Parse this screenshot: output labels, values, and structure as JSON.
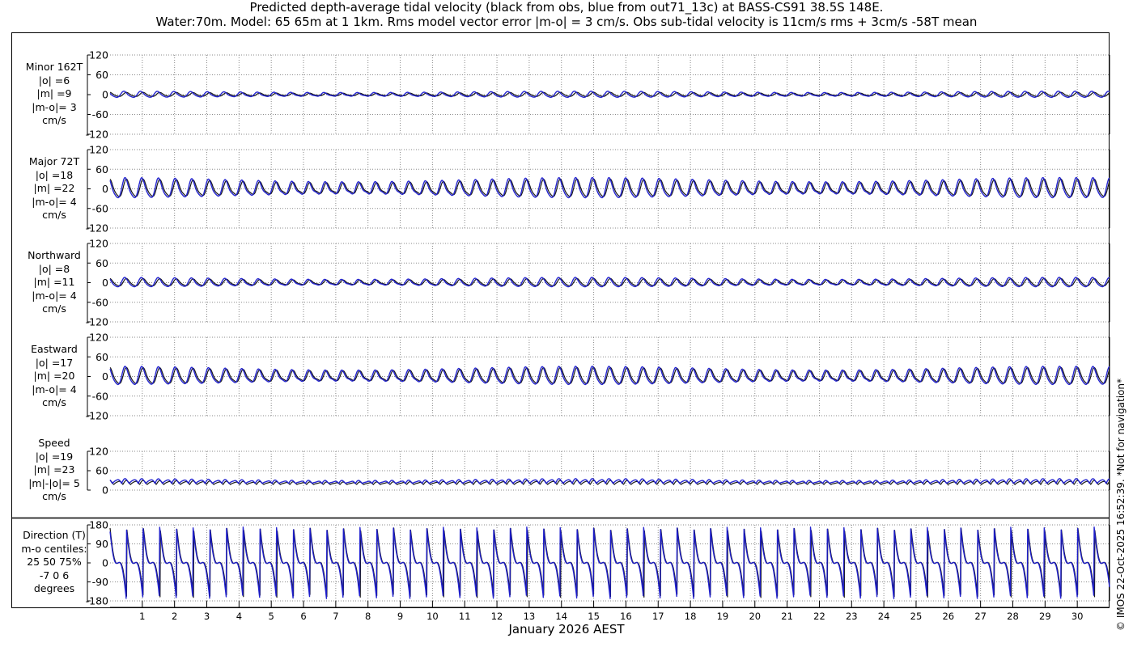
{
  "title_line1": "Predicted depth-average tidal velocity (black from obs, blue from out71_13c) at BASS-CS91 38.5S 148E.",
  "title_line2": "Water:70m. Model: 65 65m at 1 1km. Rms model vector error |m-o| = 3 cm/s. Obs sub-tidal velocity is 11cm/s rms + 3cm/s -58T mean",
  "xlabel": "January 2026 AEST",
  "credit": "© IMOS 22-Oct-2025 16:52:39. *Not for navigation*",
  "colors": {
    "obs": "#000000",
    "model": "#1a1acd",
    "grid": "#8a8a8a"
  },
  "panels": [
    {
      "id": "minor",
      "label_lines": [
        "Minor 162T",
        "|o| =6",
        "|m| =9",
        "|m-o|= 3",
        "cm/s"
      ]
    },
    {
      "id": "major",
      "label_lines": [
        "Major 72T",
        "|o| =18",
        "|m| =22",
        "|m-o|= 4",
        "cm/s"
      ]
    },
    {
      "id": "north",
      "label_lines": [
        "Northward",
        "|o| =8",
        "|m| =11",
        "|m-o|= 4",
        "cm/s"
      ]
    },
    {
      "id": "east",
      "label_lines": [
        "Eastward",
        "|o| =17",
        "|m| =20",
        "|m-o|= 4",
        "cm/s"
      ]
    },
    {
      "id": "speed",
      "label_lines": [
        "Speed",
        "|o| =19",
        "|m| =23",
        "|m|-|o|= 5",
        "cm/s"
      ]
    },
    {
      "id": "dir",
      "label_lines": [
        "Direction (T)",
        "m-o centiles:",
        "25  50  75%",
        "-7  0  6",
        "degrees"
      ]
    }
  ],
  "chart_data": [
    {
      "type": "line",
      "title": "Minor 162T",
      "ylabel": "cm/s",
      "ylim": [
        -120,
        120
      ],
      "yticks": [
        -120,
        -60,
        0,
        60,
        120
      ],
      "xlim": [
        0,
        31
      ],
      "grid": true,
      "xticks": [
        1,
        2,
        3,
        4,
        5,
        6,
        7,
        8,
        9,
        10,
        11,
        12,
        13,
        14,
        15,
        16,
        17,
        18,
        19,
        20,
        21,
        22,
        23,
        24,
        25,
        26,
        27,
        28,
        29,
        30
      ],
      "stats": {
        "obs_rms": 6,
        "model_rms": 9,
        "rms_error": 3
      },
      "series": [
        {
          "name": "obs",
          "amp": 6,
          "phase": 0.0,
          "mean": 0,
          "nonneg": false
        },
        {
          "name": "model",
          "amp": 9,
          "phase": 0.15,
          "mean": 0,
          "nonneg": false
        }
      ]
    },
    {
      "type": "line",
      "title": "Major 72T",
      "ylabel": "cm/s",
      "ylim": [
        -120,
        120
      ],
      "yticks": [
        -120,
        -60,
        0,
        60,
        120
      ],
      "xlim": [
        0,
        31
      ],
      "grid": true,
      "xticks": [
        1,
        2,
        3,
        4,
        5,
        6,
        7,
        8,
        9,
        10,
        11,
        12,
        13,
        14,
        15,
        16,
        17,
        18,
        19,
        20,
        21,
        22,
        23,
        24,
        25,
        26,
        27,
        28,
        29,
        30
      ],
      "stats": {
        "obs_rms": 18,
        "model_rms": 22,
        "rms_error": 4
      },
      "series": [
        {
          "name": "obs",
          "amp": 26,
          "phase": 0.0,
          "mean": 0,
          "nonneg": false
        },
        {
          "name": "model",
          "amp": 30,
          "phase": 0.08,
          "mean": 0,
          "nonneg": false
        }
      ]
    },
    {
      "type": "line",
      "title": "Northward",
      "ylabel": "cm/s",
      "ylim": [
        -120,
        120
      ],
      "yticks": [
        -120,
        -60,
        0,
        60,
        120
      ],
      "xlim": [
        0,
        31
      ],
      "grid": true,
      "xticks": [
        1,
        2,
        3,
        4,
        5,
        6,
        7,
        8,
        9,
        10,
        11,
        12,
        13,
        14,
        15,
        16,
        17,
        18,
        19,
        20,
        21,
        22,
        23,
        24,
        25,
        26,
        27,
        28,
        29,
        30
      ],
      "stats": {
        "obs_rms": 8,
        "model_rms": 11,
        "rms_error": 4
      },
      "series": [
        {
          "name": "obs",
          "amp": 11,
          "phase": 0.0,
          "mean": 0,
          "nonneg": false
        },
        {
          "name": "model",
          "amp": 14,
          "phase": 0.1,
          "mean": 0,
          "nonneg": false
        }
      ]
    },
    {
      "type": "line",
      "title": "Eastward",
      "ylabel": "cm/s",
      "ylim": [
        -120,
        120
      ],
      "yticks": [
        -120,
        -60,
        0,
        60,
        120
      ],
      "xlim": [
        0,
        31
      ],
      "grid": true,
      "xticks": [
        1,
        2,
        3,
        4,
        5,
        6,
        7,
        8,
        9,
        10,
        11,
        12,
        13,
        14,
        15,
        16,
        17,
        18,
        19,
        20,
        21,
        22,
        23,
        24,
        25,
        26,
        27,
        28,
        29,
        30
      ],
      "stats": {
        "obs_rms": 17,
        "model_rms": 20,
        "rms_error": 4
      },
      "series": [
        {
          "name": "obs",
          "amp": 24,
          "phase": 0.0,
          "mean": 0,
          "nonneg": false
        },
        {
          "name": "model",
          "amp": 27,
          "phase": 0.08,
          "mean": 0,
          "nonneg": false
        }
      ]
    },
    {
      "type": "line",
      "title": "Speed",
      "ylabel": "cm/s",
      "ylim": [
        0,
        120
      ],
      "yticks": [
        0,
        60,
        120
      ],
      "xlim": [
        0,
        31
      ],
      "grid": true,
      "xticks": [
        1,
        2,
        3,
        4,
        5,
        6,
        7,
        8,
        9,
        10,
        11,
        12,
        13,
        14,
        15,
        16,
        17,
        18,
        19,
        20,
        21,
        22,
        23,
        24,
        25,
        26,
        27,
        28,
        29,
        30
      ],
      "stats": {
        "obs_rms": 19,
        "model_rms": 23,
        "speed_diff": 5
      },
      "series": [
        {
          "name": "obs",
          "amp": 11,
          "phase": 0.0,
          "mean": 21,
          "nonneg": true
        },
        {
          "name": "model",
          "amp": 13,
          "phase": 0.08,
          "mean": 25,
          "nonneg": true
        }
      ]
    },
    {
      "type": "line",
      "title": "Direction (T)",
      "ylabel": "degrees",
      "ylim": [
        -180,
        180
      ],
      "yticks": [
        -180,
        -90,
        0,
        90,
        180
      ],
      "xlim": [
        0,
        31
      ],
      "grid": true,
      "xticks": [
        1,
        2,
        3,
        4,
        5,
        6,
        7,
        8,
        9,
        10,
        11,
        12,
        13,
        14,
        15,
        16,
        17,
        18,
        19,
        20,
        21,
        22,
        23,
        24,
        25,
        26,
        27,
        28,
        29,
        30
      ],
      "centiles": {
        "p25": -7,
        "p50": 0,
        "p75": 6
      },
      "series": [
        {
          "name": "obs",
          "kind": "sawtooth",
          "low": -165,
          "high": 165,
          "phase": 0.0
        },
        {
          "name": "model",
          "kind": "sawtooth",
          "low": -170,
          "high": 170,
          "phase": 0.03
        }
      ]
    }
  ]
}
